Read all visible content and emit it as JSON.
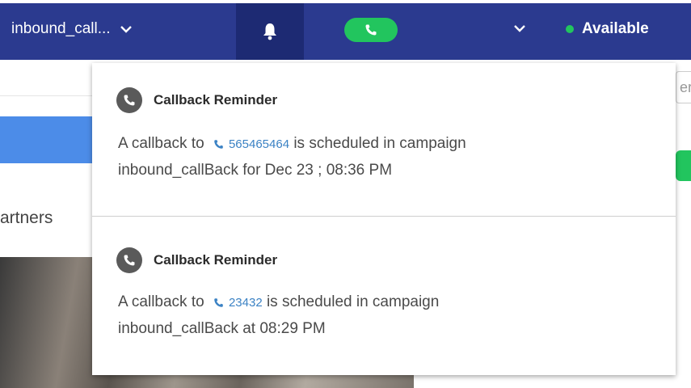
{
  "topbar": {
    "campaign_label": "inbound_call...",
    "status_label": "Available",
    "icons": {
      "campaign_dropdown": "chevron-down-icon",
      "notifications": "bell-icon",
      "call": "phone-icon",
      "status_dropdown": "chevron-down-icon"
    }
  },
  "background": {
    "partners_text": "artners",
    "input_text": "er"
  },
  "notifications": [
    {
      "title": "Callback Reminder",
      "body_prefix": "A callback to",
      "number": "565465464",
      "body_suffix": "is scheduled in campaign",
      "body_line2": "inbound_callBack for Dec 23 ; 08:36 PM"
    },
    {
      "title": "Callback Reminder",
      "body_prefix": "A callback to",
      "number": "23432",
      "body_suffix": "is scheduled in campaign",
      "body_line2": "inbound_callBack at 08:29 PM"
    }
  ],
  "colors": {
    "topbar": "#2b3a8f",
    "bell_active": "#1d2a73",
    "call_green": "#22c55e",
    "link_blue": "#3b82c4"
  }
}
